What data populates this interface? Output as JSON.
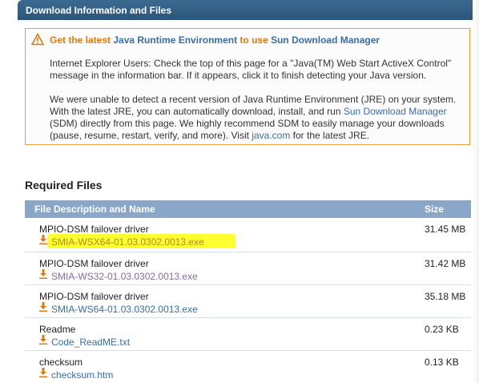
{
  "header": {
    "title": "Download Information and Files"
  },
  "notice": {
    "title_part1": "Get the latest ",
    "title_part2": "Java Runtime Environment",
    "title_part3": " to use ",
    "title_part4": "Sun Download Manager",
    "para1": "Internet Explorer Users: Check the top of this page for a \"Java(TM) Web Start ActiveX Control\" message in the information bar. If it appears, click it to finish detecting your Java version.",
    "para2_a": "We were unable to detect a recent version of Java Runtime Environment (JRE) on your system. With the latest JRE, you can automatically download, install, and run ",
    "para2_link1": "Sun Download Manager",
    "para2_b": " (SDM) directly from this page. We highly recommend SDM to easily manage your downloads (pause, resume, restart, verify, and more). Visit ",
    "para2_link2": "java.com",
    "para2_c": " for the latest JRE."
  },
  "required_files": {
    "title": "Required Files",
    "col_name": "File Description and Name",
    "col_size": "Size",
    "rows": [
      {
        "description": "MPIO-DSM failover driver",
        "file": "SMIA-WSX64-01.03.0302.0013.exe",
        "size": "31.45 MB"
      },
      {
        "description": "MPIO-DSM failover driver",
        "file": "SMIA-WS32-01.03.0302.0013.exe",
        "size": "31.42 MB"
      },
      {
        "description": "MPIO-DSM failover driver",
        "file": "SMIA-WS64-01.03.0302.0013.exe",
        "size": "35.18 MB"
      },
      {
        "description": "Readme",
        "file": "Code_ReadME.txt",
        "size": "0.23 KB"
      },
      {
        "description": "checksum",
        "file": "checksum.htm",
        "size": "0.13 KB"
      }
    ]
  },
  "colors": {
    "header": "#2f5a7e",
    "notice_border": "#e8a040",
    "accent_orange": "#e07a10",
    "link": "#3a6ea5",
    "table_header": "#8aa7c7",
    "highlight": "#ffff30"
  },
  "icons": {
    "warning": "warning-triangle-icon",
    "download": "download-arrow-icon"
  }
}
